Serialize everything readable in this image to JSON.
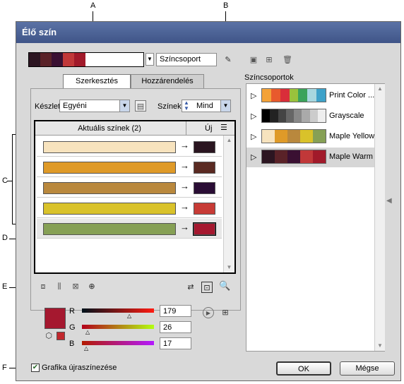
{
  "callouts": [
    "A",
    "B",
    "C",
    "D",
    "E",
    "F"
  ],
  "window_title": "Élő szín",
  "top": {
    "current_group_swatches": [
      "#2c1521",
      "#5a2228",
      "#3a1032",
      "#c13839",
      "#a11a2a",
      "#ffffff"
    ],
    "group_name": "Színcsoport"
  },
  "tabs": {
    "edit": "Szerkesztés",
    "assign": "Hozzárendelés"
  },
  "preset": {
    "label": "Készlet:",
    "value": "Egyéni"
  },
  "colors": {
    "label": "Színek:",
    "value": "Mind"
  },
  "table": {
    "col_current": "Aktuális színek (2)",
    "col_new": "Új",
    "rows": [
      {
        "current": "#f7e3be",
        "new": "#2a1520"
      },
      {
        "current": "#df9a28",
        "new": "#5a2a22"
      },
      {
        "current": "#b9883d",
        "new": "#2a0d35"
      },
      {
        "current": "#d9c22a",
        "new": "#c73b36"
      },
      {
        "current": "#86a055",
        "new": "#a5182f"
      }
    ],
    "arrow": "→"
  },
  "rgb": {
    "swatch": "#a5182f",
    "r": {
      "label": "R",
      "value": "179"
    },
    "g": {
      "label": "G",
      "value": "26"
    },
    "b": {
      "label": "B",
      "value": "17"
    }
  },
  "recolor_checkbox": {
    "label": "Grafika újraszínezése",
    "checked": true
  },
  "groups_title": "Színcsoportok",
  "groups": [
    {
      "name": "Print Color ...",
      "swatches": [
        "#f4a238",
        "#e85a2d",
        "#d92e3a",
        "#9ac23c",
        "#3ba35b",
        "#a7d7df",
        "#3ea2c9"
      ]
    },
    {
      "name": "Grayscale",
      "swatches": [
        "#000000",
        "#222222",
        "#444444",
        "#666666",
        "#888888",
        "#aaaaaa",
        "#cccccc",
        "#eeeeee"
      ]
    },
    {
      "name": "Maple Yellow",
      "swatches": [
        "#f7e3be",
        "#df9a28",
        "#b9883d",
        "#d9c22a",
        "#86a055"
      ]
    },
    {
      "name": "Maple Warm",
      "swatches": [
        "#2c1521",
        "#5a2228",
        "#3a1032",
        "#c13839",
        "#a11a2a"
      ]
    }
  ],
  "buttons": {
    "ok": "OK",
    "cancel": "Mégse"
  }
}
